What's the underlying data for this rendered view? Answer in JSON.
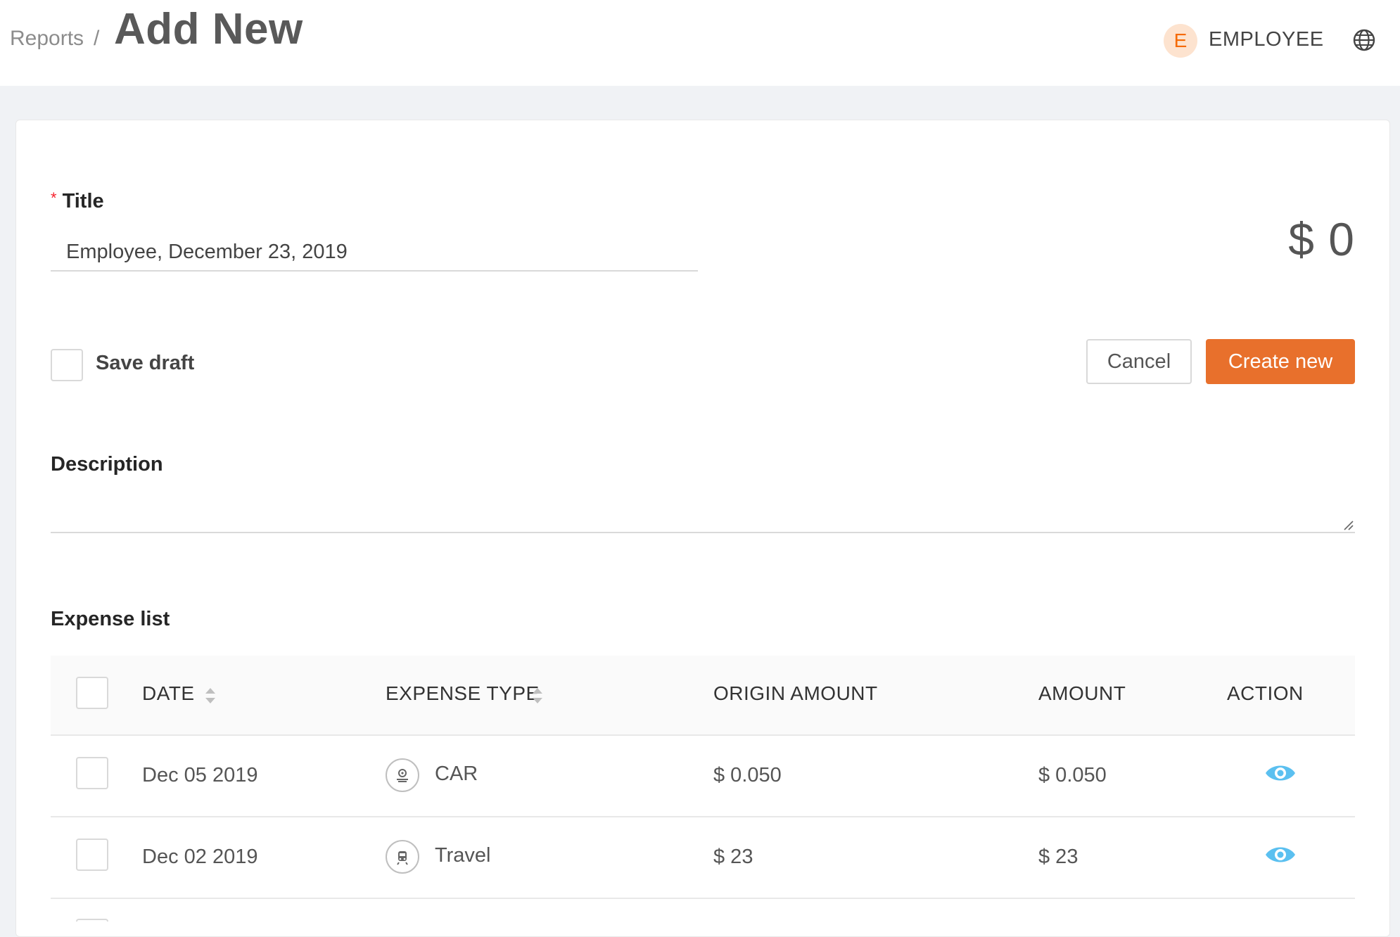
{
  "header": {
    "breadcrumb_parent": "Reports",
    "breadcrumb_separator": "/",
    "page_title": "Add New",
    "avatar_initial": "E",
    "user_name": "EMPLOYEE",
    "language_icon": "globe-icon"
  },
  "form": {
    "title_label": "Title",
    "required_mark": "*",
    "title_value": "Employee, December 23, 2019",
    "total": "$ 0",
    "save_draft_label": "Save draft",
    "save_draft_checked": false,
    "cancel_label": "Cancel",
    "create_label": "Create new",
    "description_label": "Description",
    "description_value": ""
  },
  "expense_list": {
    "label": "Expense list",
    "columns": {
      "date": "DATE",
      "expense_type": "EXPENSE TYPE",
      "origin_amount": "ORIGIN AMOUNT",
      "amount": "AMOUNT",
      "action": "ACTION"
    },
    "rows": [
      {
        "date": "Dec 05 2019",
        "type": "CAR",
        "type_icon": "car-icon",
        "origin_amount": "$ 0.050",
        "amount": "$ 0.050",
        "action_icon": "eye-icon"
      },
      {
        "date": "Dec 02 2019",
        "type": "Travel",
        "type_icon": "travel-icon",
        "origin_amount": "$ 23",
        "amount": "$ 23",
        "action_icon": "eye-icon"
      }
    ]
  },
  "colors": {
    "accent": "#e8702c",
    "avatar_bg": "#fde3cf",
    "avatar_fg": "#f56a00",
    "eye_icon": "#5bc0f0",
    "required": "#f5222d"
  }
}
